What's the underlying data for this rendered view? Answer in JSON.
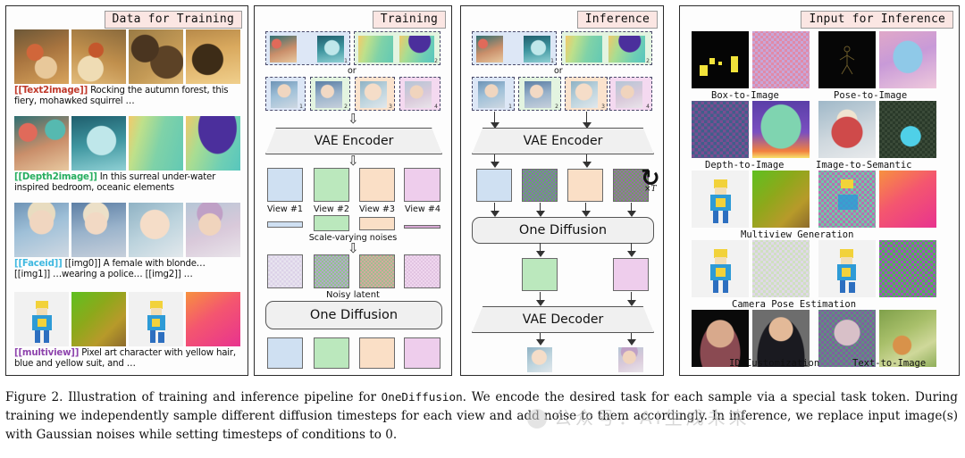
{
  "figure": {
    "caption_prefix": "Figure 2.",
    "caption_part1": " Illustration of training and inference pipeline for ",
    "caption_mono": "OneDiffusion",
    "caption_part2": ". We encode the desired task for each sample via a special task token. During training we independently sample different diffusion timesteps for each view and add noise to them accordingly. In inference, we replace input image(s) with Gaussian noises while setting timesteps of conditions to 0.",
    "watermark": "公众号：AI生成未来"
  },
  "panels": {
    "data": {
      "header": "Data for Training",
      "rows": [
        {
          "token": "[[Text2image]]",
          "token_color": "#c0392b",
          "text": " Rocking the autumn forest, this fiery, mohawked squirrel …",
          "thumbs": [
            "squirrel-drums-1",
            "squirrel-drums-2",
            "drum-closeup",
            "drum-bokeh"
          ]
        },
        {
          "token": "[[Depth2image]]",
          "token_color": "#27ae60",
          "text": " In this surreal under-water inspired bedroom, oceanic elements",
          "thumbs": [
            "bedroom-coral",
            "bedroom-underwater",
            "depthmap-teal",
            "depthmap-blob"
          ]
        },
        {
          "token": "[[Faceid]]",
          "token_color": "#3fb8e0",
          "text": " [[img0]] A female with blonde… [[img1]] …wearing a police… [[img2]] …",
          "thumbs": [
            "face-braids-1",
            "face-braids-2",
            "face-closeup",
            "face-winter"
          ]
        },
        {
          "token": "[[multiview]]",
          "token_color": "#8e44ad",
          "text": " Pixel art character with yellow hair, blue and yellow suit, and …",
          "thumbs": [
            "pixelart-front",
            "gradient-olive",
            "pixelart-side",
            "gradient-pink"
          ]
        }
      ]
    },
    "training": {
      "header": "Training",
      "or_label": "or",
      "vae_encoder": "VAE Encoder",
      "one_diffusion": "One Diffusion",
      "view_labels": [
        "View #1",
        "View #2",
        "View #3",
        "View #4"
      ],
      "scale_label": "Scale-varying noises",
      "noisy_label": "Noisy latent",
      "group_indices": [
        "1",
        "2",
        "1",
        "2",
        "3",
        "4"
      ]
    },
    "inference": {
      "header": "Inference",
      "or_label": "or",
      "vae_encoder": "VAE Encoder",
      "one_diffusion": "One Diffusion",
      "vae_decoder": "VAE Decoder",
      "loop_label": "×T",
      "group_indices": [
        "1",
        "2",
        "1",
        "2",
        "3",
        "4"
      ]
    },
    "input": {
      "header": "Input for Inference",
      "labels": [
        "Box-to-Image",
        "Pose-to-Image",
        "Depth-to-Image",
        "Image-to-Semantic",
        "Multiview Generation",
        "Camera Pose Estimation",
        "ID Customization",
        "Text-to-Image"
      ],
      "cells": [
        "box-condition",
        "noise-pink",
        "pose-skeleton",
        "generated-doll",
        "depth-city",
        "depth-purple",
        "doll-street",
        "semantic-noise",
        "pixelart-front",
        "gradient-olive",
        "noise-pixelart",
        "gradient-pink",
        "pixelart-front2",
        "noise-pastel",
        "pixelart-side",
        "noise-rainbow",
        "id-photo-female",
        "id-photo-male",
        "noise-portrait",
        "forest-painting"
      ]
    }
  },
  "colors": {
    "latent_blue": "#cfe0f2",
    "latent_green": "#bbe8bd",
    "latent_peach": "#fadfc6",
    "latent_pink": "#eecdec",
    "header_bg": "#fbe6e3"
  }
}
